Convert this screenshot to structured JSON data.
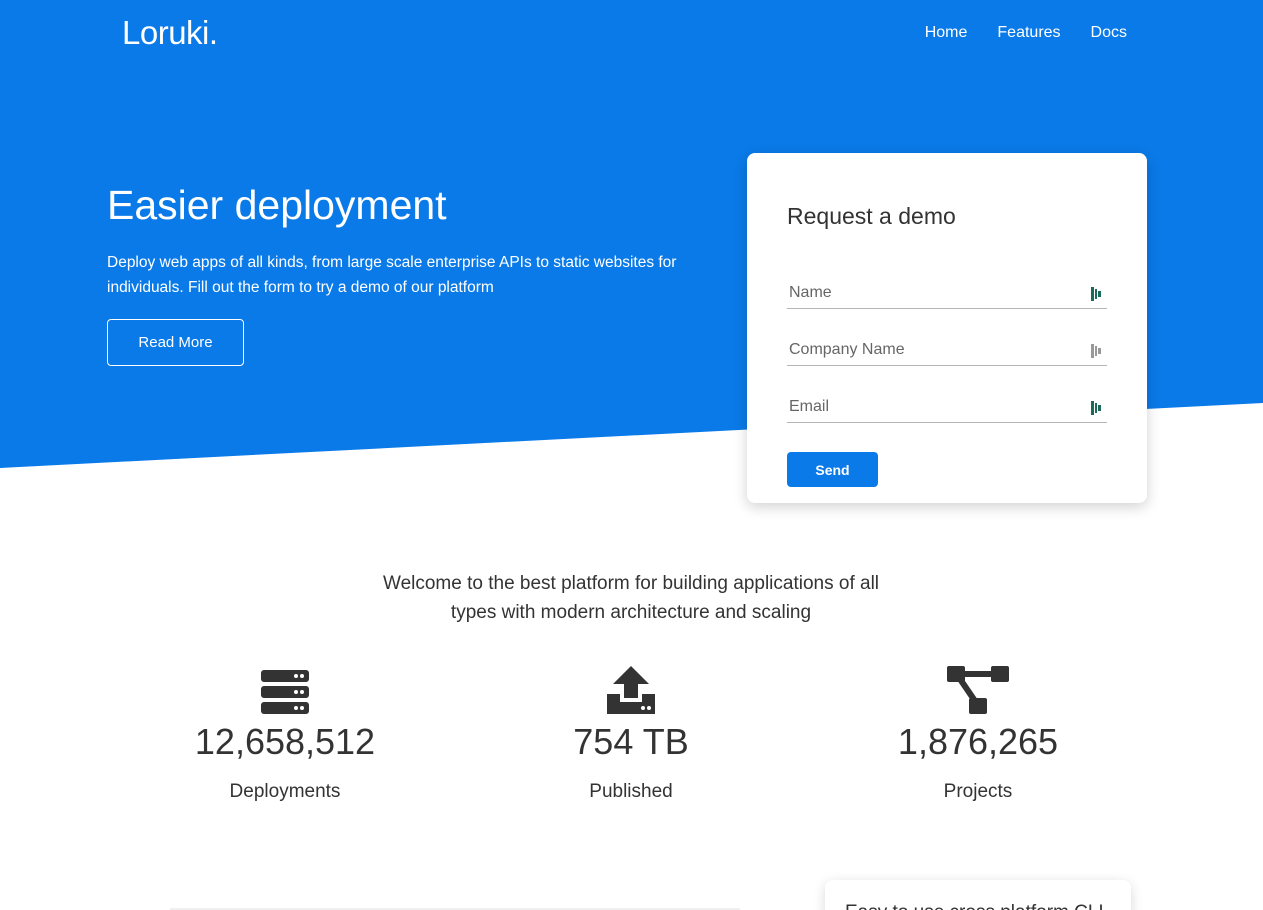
{
  "brand": {
    "logo": "Loruki.",
    "primary_color": "#0a7ae8"
  },
  "nav": {
    "items": [
      "Home",
      "Features",
      "Docs"
    ]
  },
  "hero": {
    "title": "Easier deployment",
    "description": "Deploy web apps of all kinds, from large scale enterprise APIs to static websites for individuals. Fill out the form to try a demo of our platform",
    "button": "Read More"
  },
  "demo_form": {
    "title": "Request a demo",
    "fields": [
      {
        "placeholder": "Name",
        "value": ""
      },
      {
        "placeholder": "Company Name",
        "value": ""
      },
      {
        "placeholder": "Email",
        "value": ""
      }
    ],
    "submit": "Send"
  },
  "welcome": {
    "text": "Welcome to the best platform for building applications of all types with modern architecture and scaling"
  },
  "stats": [
    {
      "icon": "server-icon",
      "value": "12,658,512",
      "label": "Deployments"
    },
    {
      "icon": "upload-icon",
      "value": "754 TB",
      "label": "Published"
    },
    {
      "icon": "project-diagram-icon",
      "value": "1,876,265",
      "label": "Projects"
    }
  ],
  "bottom_card": {
    "text": "Easy to use cross platform CLI"
  }
}
